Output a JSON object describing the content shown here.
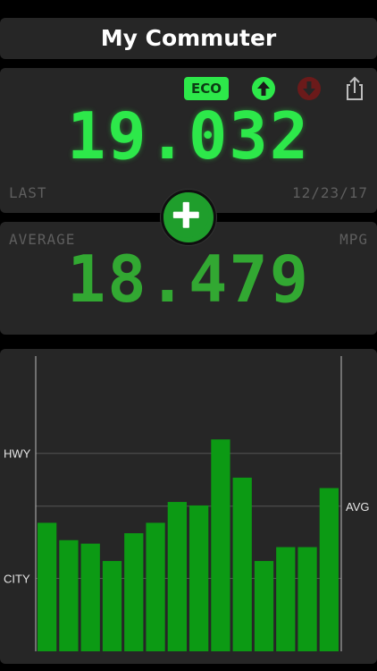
{
  "header": {
    "title": "My Commuter"
  },
  "last_entry": {
    "eco_label": "ECO",
    "value": "19.032",
    "label": "LAST",
    "date": "12/23/17",
    "icons": [
      "arrow-up-icon",
      "arrow-down-icon",
      "share-icon"
    ]
  },
  "average": {
    "label": "AVERAGE",
    "unit": "MPG",
    "value": "18.479"
  },
  "add_button": {
    "icon": "plus-icon"
  },
  "colors": {
    "accent": "#2de84a",
    "bar": "#0c9a14",
    "panel": "#262626",
    "down_disabled": "#6b1a1a"
  },
  "chart_data": {
    "type": "bar",
    "values": [
      18.0,
      17.5,
      17.4,
      16.9,
      17.7,
      18.0,
      18.6,
      18.5,
      20.4,
      19.3,
      16.9,
      17.3,
      17.3,
      19.0
    ],
    "reference_lines": [
      {
        "label": "HWY",
        "value": 20.0
      },
      {
        "label": "AVG",
        "value": 18.479
      },
      {
        "label": "CITY",
        "value": 16.4
      }
    ],
    "ylim": [
      14.3,
      22.8
    ],
    "grid": true
  }
}
